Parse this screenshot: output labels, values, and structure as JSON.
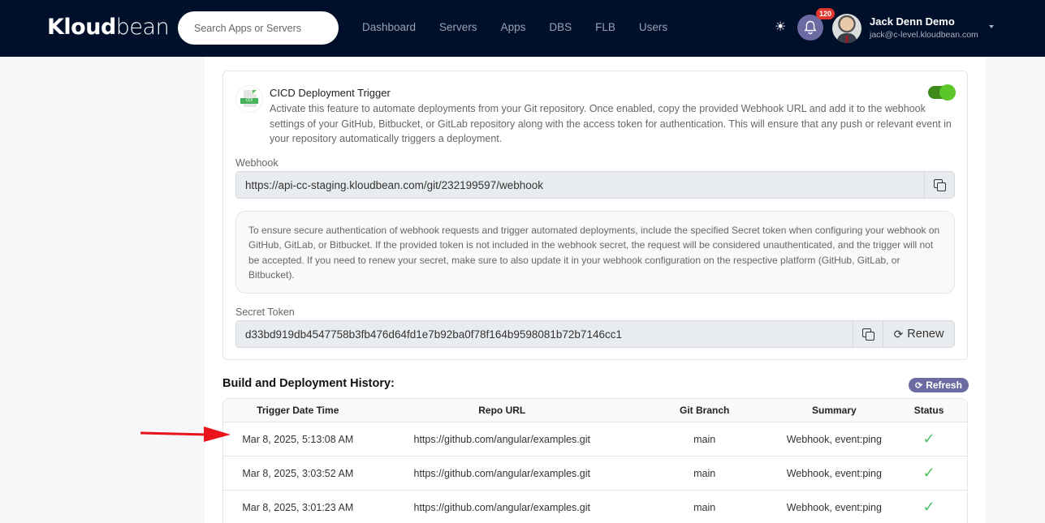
{
  "header": {
    "logo": {
      "bold": "Kloud",
      "light": "bean"
    },
    "search_placeholder": "Search Apps or Servers",
    "nav": [
      "Dashboard",
      "Servers",
      "Apps",
      "DBS",
      "FLB",
      "Users"
    ],
    "notification_count": "120",
    "user": {
      "name": "Jack Denn Demo",
      "email": "jack@c-level.kloudbean.com"
    }
  },
  "cicd": {
    "icon_label": "CDI",
    "title": "CICD Deployment Trigger",
    "description": "Activate this feature to automate deployments from your Git repository. Once enabled, copy the provided Webhook URL and add it to the webhook settings of your GitHub, Bitbucket, or GitLab repository along with the access token for authentication. This will ensure that any push or relevant event in your repository automatically triggers a deployment.",
    "enabled": true,
    "webhook_label": "Webhook",
    "webhook_url": "https://api-cc-staging.kloudbean.com/git/232199597/webhook",
    "info": "To ensure secure authentication of webhook requests and trigger automated deployments, include the specified Secret token when configuring your webhook on GitHub, GitLab, or Bitbucket. If the provided token is not included in the webhook secret, the request will be considered unauthenticated, and the trigger will not be accepted. If you need to renew your secret, make sure to also update it in your webhook configuration on the respective platform (GitHub, GitLab, or Bitbucket).",
    "secret_label": "Secret Token",
    "secret_token": "d33bd919db4547758b3fb476d64fd1e7b92ba0f78f164b9598081b72b7146cc1",
    "renew_label": "Renew"
  },
  "history": {
    "title": "Build and Deployment History:",
    "refresh_label": "Refresh",
    "columns": [
      "Trigger Date Time",
      "Repo URL",
      "Git Branch",
      "Summary",
      "Status"
    ],
    "rows": [
      {
        "datetime": "Mar 8, 2025, 5:13:08 AM",
        "repo": "https://github.com/angular/examples.git",
        "branch": "main",
        "summary": "Webhook, event:ping",
        "status": "success"
      },
      {
        "datetime": "Mar 8, 2025, 3:03:52 AM",
        "repo": "https://github.com/angular/examples.git",
        "branch": "main",
        "summary": "Webhook, event:ping",
        "status": "success"
      },
      {
        "datetime": "Mar 8, 2025, 3:01:23 AM",
        "repo": "https://github.com/angular/examples.git",
        "branch": "main",
        "summary": "Webhook, event:ping",
        "status": "success"
      }
    ]
  },
  "colors": {
    "navbar": "#00102a",
    "accent": "#6b6aa3",
    "toggle_on": "#5ac62a",
    "success": "#4cbf64",
    "annotation_arrow": "#e8131b"
  }
}
